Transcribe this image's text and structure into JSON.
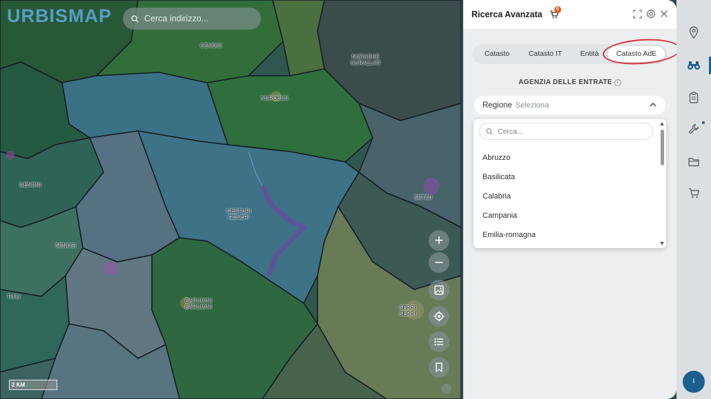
{
  "map": {
    "logo_text": "URBISMAP",
    "search_placeholder": "Cerca indirizzo...",
    "zoom_in": "+",
    "zoom_out": "−",
    "scale_label": "2 KM",
    "place_labels": [
      "CENONI",
      "NURAGHE\nNURALLAO",
      "NUROBUS",
      "GESTURI\nGENERI",
      "SENOSI",
      "BARUMINI\nBARUMINI",
      "TUILI",
      "SETZU",
      "GENONI",
      "SERRI\nSERRI"
    ]
  },
  "panel": {
    "title": "Ricerca Avanzata",
    "cart_badge": "0",
    "tabs": [
      {
        "label": "Catasto"
      },
      {
        "label": "Catasto IT"
      },
      {
        "label": "Entità"
      },
      {
        "label": "Catasto AdE"
      }
    ],
    "section_title": "AGENZIA DELLE ENTRATE",
    "info_icon_text": "i",
    "region": {
      "label": "Regione",
      "value": "Seleziona"
    },
    "dropdown": {
      "search_placeholder": "Cerca...",
      "items": [
        "Abruzzo",
        "Basilicata",
        "Calabria",
        "Campania",
        "Emilia-romagna"
      ]
    }
  },
  "sidebar": {
    "icons": [
      "map-pin-icon",
      "binoculars-icon",
      "clipboard-icon",
      "wrench-icon",
      "folder-icon",
      "cart-icon"
    ],
    "avatar_initial": "I"
  },
  "colors": {
    "accent": "#1b5f8f",
    "annotation": "#d9323a",
    "badge": "#e55a1f"
  }
}
